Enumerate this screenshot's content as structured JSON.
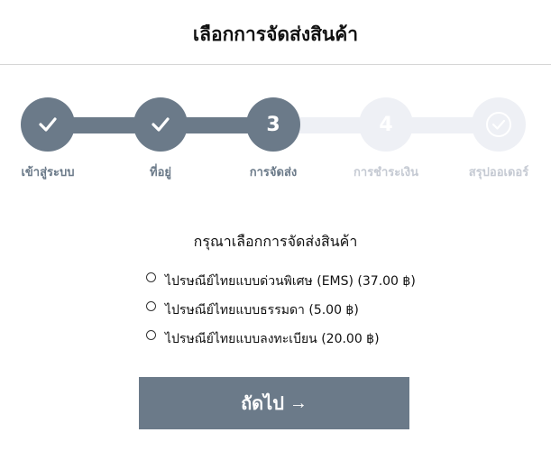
{
  "header": {
    "title": "เลือกการจัดส่งสินค้า"
  },
  "steps": [
    {
      "label": "เข้าสู่ระบบ",
      "state": "done",
      "icon": "check-icon"
    },
    {
      "label": "ที่อยู่",
      "state": "done",
      "icon": "check-icon"
    },
    {
      "label": "การจัดส่ง",
      "state": "current",
      "number": "3"
    },
    {
      "label": "การชำระเงิน",
      "state": "future",
      "number": "4"
    },
    {
      "label": "สรุปออเดอร์",
      "state": "final",
      "icon": "check-circle-icon"
    }
  ],
  "shipping": {
    "prompt": "กรุณาเลือกการจัดส่งสินค้า",
    "options": [
      {
        "label": "ไปรษณีย์ไทยแบบด่วนพิเศษ (EMS) (37.00 ฿)",
        "selected": false
      },
      {
        "label": "ไปรษณีย์ไทยแบบธรรมดา (5.00 ฿)",
        "selected": false
      },
      {
        "label": "ไปรษณีย์ไทยแบบลงทะเบียน (20.00 ฿)",
        "selected": false
      }
    ]
  },
  "next_button": {
    "label": "ถัดไป",
    "arrow": "→"
  },
  "colors": {
    "accent": "#6b7a89",
    "inactive": "#eef0f5",
    "inactive_text": "#c5cad3"
  }
}
